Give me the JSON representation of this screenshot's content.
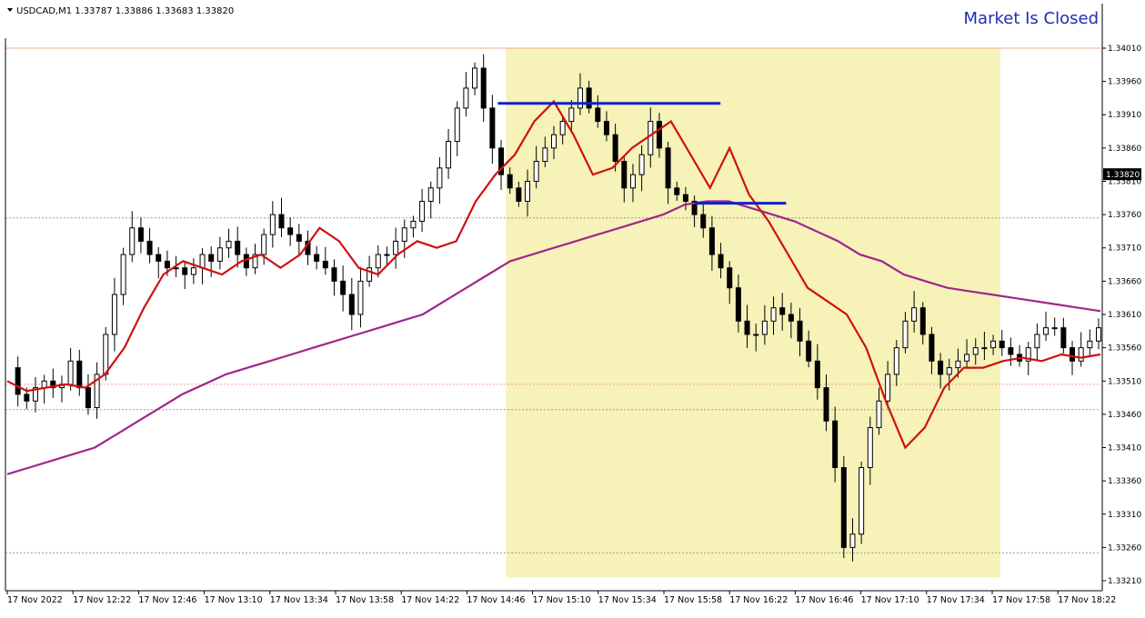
{
  "header": {
    "symbol_line": "USDCAD,M1  1.33787 1.33886 1.33683 1.33820",
    "status": "Market Is Closed"
  },
  "colors": {
    "background": "#ffffff",
    "candles": "#000000",
    "ma_fast": "#d01010",
    "ma_slow": "#a0268a",
    "highlight_zone": "#f6f2b8",
    "trendlines": "#1020d0",
    "status_text": "#1a2fb0"
  },
  "chart_data": {
    "type": "candlestick",
    "symbol": "USDCAD",
    "timeframe": "M1",
    "ohlc_header": {
      "open": 1.33787,
      "high": 1.33886,
      "low": 1.33683,
      "close": 1.3382
    },
    "current_price": 1.3382,
    "ylim": [
      1.33195,
      1.34025
    ],
    "y_ticks": [
      "1.34010",
      "1.33960",
      "1.33910",
      "1.33860",
      "1.33810",
      "1.33760",
      "1.33710",
      "1.33660",
      "1.33610",
      "1.33560",
      "1.33510",
      "1.33460",
      "1.33410",
      "1.33360",
      "1.33310",
      "1.33260",
      "1.33210"
    ],
    "x_ticks": [
      "17 Nov 2022",
      "17 Nov 12:22",
      "17 Nov 12:46",
      "17 Nov 13:10",
      "17 Nov 13:34",
      "17 Nov 13:58",
      "17 Nov 14:22",
      "17 Nov 14:46",
      "17 Nov 15:10",
      "17 Nov 15:34",
      "17 Nov 15:58",
      "17 Nov 16:22",
      "17 Nov 16:46",
      "17 Nov 17:10",
      "17 Nov 17:34",
      "17 Nov 17:58",
      "17 Nov 18:22"
    ],
    "bars_per_tick": 24,
    "close_series": [
      1.3353,
      1.3349,
      1.3348,
      1.335,
      1.3351,
      1.335,
      1.33505,
      1.3354,
      1.335,
      1.3347,
      1.3352,
      1.3358,
      1.3364,
      1.337,
      1.3374,
      1.3372,
      1.337,
      1.3369,
      1.3368,
      1.3368,
      1.3367,
      1.3368,
      1.337,
      1.3369,
      1.3371,
      1.3372,
      1.337,
      1.3368,
      1.337,
      1.3373,
      1.3376,
      1.3374,
      1.3373,
      1.3372,
      1.337,
      1.3369,
      1.3368,
      1.3366,
      1.3364,
      1.3361,
      1.3366,
      1.3368,
      1.337,
      1.337,
      1.3372,
      1.3374,
      1.3375,
      1.3378,
      1.338,
      1.3383,
      1.3387,
      1.3392,
      1.3395,
      1.3398,
      1.3392,
      1.3386,
      1.3382,
      1.338,
      1.3378,
      1.3381,
      1.3384,
      1.3386,
      1.3388,
      1.339,
      1.3392,
      1.3395,
      1.3392,
      1.339,
      1.3388,
      1.3384,
      1.338,
      1.3382,
      1.3385,
      1.339,
      1.3386,
      1.338,
      1.3379,
      1.3378,
      1.3376,
      1.3374,
      1.337,
      1.3368,
      1.3365,
      1.336,
      1.3358,
      1.3358,
      1.336,
      1.3362,
      1.3361,
      1.336,
      1.3357,
      1.3354,
      1.335,
      1.3345,
      1.3338,
      1.3326,
      1.3328,
      1.3338,
      1.3344,
      1.3348,
      1.3352,
      1.3356,
      1.336,
      1.3362,
      1.3358,
      1.3354,
      1.3352,
      1.3353,
      1.3354,
      1.3355,
      1.3356,
      1.3356,
      1.3357,
      1.3356,
      1.3355,
      1.3354,
      1.3356,
      1.3358,
      1.3359,
      1.3359,
      1.3356,
      1.3354,
      1.3356,
      1.3357,
      1.3359
    ],
    "ma_fast": [
      1.3351,
      1.33495,
      1.335,
      1.33505,
      1.335,
      1.3352,
      1.3356,
      1.3362,
      1.3367,
      1.3369,
      1.3368,
      1.3367,
      1.3369,
      1.337,
      1.3368,
      1.337,
      1.3374,
      1.3372,
      1.3368,
      1.3367,
      1.337,
      1.3372,
      1.3371,
      1.3372,
      1.3378,
      1.3382,
      1.3385,
      1.339,
      1.3393,
      1.3388,
      1.3382,
      1.3383,
      1.3386,
      1.3388,
      1.339,
      1.3385,
      1.338,
      1.3386,
      1.3379,
      1.3375,
      1.337,
      1.3365,
      1.3363,
      1.3361,
      1.3356,
      1.3348,
      1.3341,
      1.3344,
      1.335,
      1.3353,
      1.3353,
      1.3354,
      1.33545,
      1.3354,
      1.3355,
      1.33545,
      1.3355
    ],
    "ma_slow": [
      1.3337,
      1.3338,
      1.3339,
      1.334,
      1.3341,
      1.3343,
      1.3345,
      1.3347,
      1.3349,
      1.33505,
      1.3352,
      1.3353,
      1.3354,
      1.3355,
      1.3356,
      1.3357,
      1.3358,
      1.3359,
      1.336,
      1.3361,
      1.3363,
      1.3365,
      1.3367,
      1.3369,
      1.337,
      1.3371,
      1.3372,
      1.3373,
      1.3374,
      1.3375,
      1.3376,
      1.33775,
      1.3378,
      1.3378,
      1.3377,
      1.3376,
      1.3375,
      1.33735,
      1.3372,
      1.337,
      1.3369,
      1.3367,
      1.3366,
      1.3365,
      1.33645,
      1.3364,
      1.33635,
      1.3363,
      1.33625,
      1.3362,
      1.33615
    ],
    "horizontal_levels": [
      1.3401,
      1.33755,
      1.33505,
      1.33467,
      1.33252
    ],
    "highlight_zone": {
      "from_label": "17 Nov 14:46",
      "to_label": "17 Nov 17:58",
      "price_from": 1.33215,
      "price_to": 1.3401
    },
    "trendlines": [
      {
        "price": 1.33927,
        "from_label": "17 Nov 14:46",
        "to_label": "17 Nov 16:22"
      },
      {
        "price": 1.33777,
        "from_label": "17 Nov 15:58",
        "to_label": "17 Nov 16:46"
      }
    ],
    "grid": false,
    "legend": "none"
  }
}
